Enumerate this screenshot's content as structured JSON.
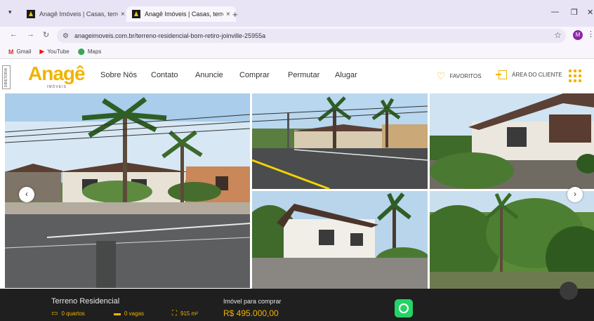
{
  "browser": {
    "tabs": [
      {
        "title": "Anagê Imóveis | Casas, terreno",
        "close": "×"
      },
      {
        "title": "Anagê Imóveis | Casas, terreno",
        "close": "×"
      }
    ],
    "new_tab": "+",
    "url": "anageimoveis.com.br/terreno-residencial-bom-retiro-joinville-25955a",
    "profile_initial": "M",
    "bookmarks": [
      {
        "icon": "gmail-icon",
        "label": "Gmail"
      },
      {
        "icon": "youtube-icon",
        "label": "YouTube"
      },
      {
        "icon": "maps-icon",
        "label": "Maps"
      }
    ]
  },
  "site": {
    "side_label": "DIRETORIA",
    "logo_text": "Anagê",
    "logo_sub": "IMÓVEIS",
    "menu": [
      "Sobre Nós",
      "Contato",
      "Anuncie",
      "Comprar",
      "Permutar",
      "Alugar"
    ],
    "favorites_label": "FAVORITOS",
    "client_area_label": "ÁREA DO CLIENTE",
    "brand_color": "#f0b400"
  },
  "listing": {
    "title": "Terreno Residencial",
    "bedrooms": "0 quartos",
    "parking": "0 vagas",
    "area": "915 m²",
    "price_label": "Imóvel para comprar",
    "price": "R$ 495.000,00"
  }
}
